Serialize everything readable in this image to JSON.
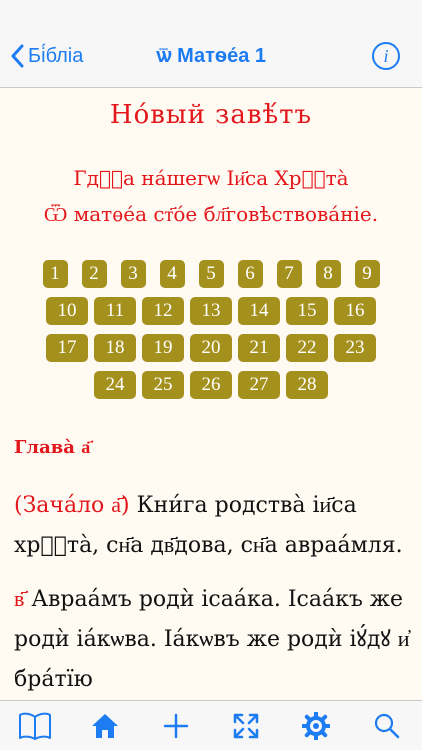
{
  "navbar": {
    "back_label": "Бі́бліа",
    "title": "ѿ Матѳе́а 1",
    "info_label": "i"
  },
  "book": {
    "title": "Но́вый завѣ́тъ",
    "subtitle_line1": "Гдⷭ҇а на́шегѡ Іи҃са Хрⷭ҇та̀",
    "subtitle_line2": "Ѿ матѳе́а ст҃о́е бл҃говѣствова́ніе."
  },
  "chapters": [
    "1",
    "2",
    "3",
    "4",
    "5",
    "6",
    "7",
    "8",
    "9",
    "10",
    "11",
    "12",
    "13",
    "14",
    "15",
    "16",
    "17",
    "18",
    "19",
    "20",
    "21",
    "22",
    "23",
    "24",
    "25",
    "26",
    "27",
    "28"
  ],
  "chapter_heading": "Глава̀ а҃",
  "verse1": {
    "marker": "(Зача́ло а҃)",
    "text": " Кни́га родства̀ іи҃са хрⷭ҇та̀, сн҃а дв҃дова, сн҃а авраа́мля."
  },
  "verse2": {
    "marker": "в҃",
    "text": " Авраа́мъ родѝ ісаа́ка. Ісаа́къ же родѝ іа́кѡва. Іа́кѡвъ же родѝ іꙋ́дꙋ и҆ бра́тїю"
  },
  "colors": {
    "accent": "#1e7cf2",
    "red_text": "#e3161b",
    "chapter_button": "#a4901d",
    "page_background": "#fffaf2"
  },
  "tabbar": {
    "icons": [
      "book-icon",
      "home-icon",
      "plus-icon",
      "fullscreen-icon",
      "gear-icon",
      "search-icon"
    ]
  }
}
